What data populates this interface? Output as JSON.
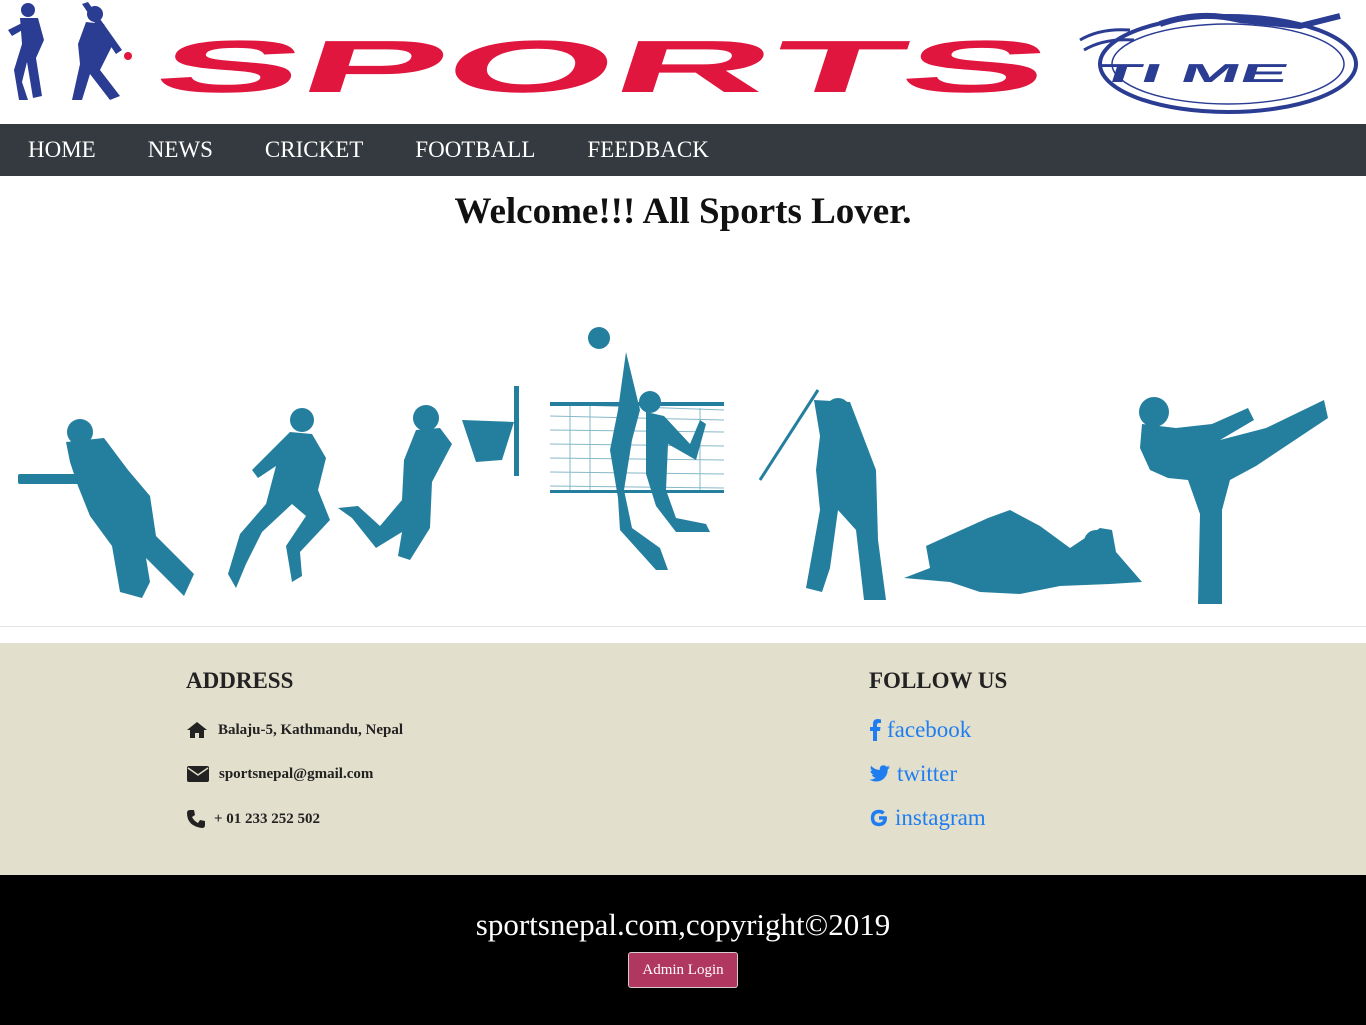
{
  "header": {
    "logo_alt": "Sports Time logo",
    "logo_text": "SPORTS",
    "logo_sub": "TI ME"
  },
  "nav": {
    "items": [
      {
        "label": "HOME"
      },
      {
        "label": "NEWS"
      },
      {
        "label": "CRICKET"
      },
      {
        "label": "FOOTBALL"
      },
      {
        "label": "FEEDBACK"
      }
    ]
  },
  "main": {
    "welcome": "Welcome!!! All Sports Lover."
  },
  "contact": {
    "address_title": "ADDRESS",
    "address": "Balaju-5, Kathmandu, Nepal",
    "email": "sportsnepal@gmail.com",
    "phone": "+ 01 233 252 502",
    "follow_title": "FOLLOW US",
    "social": [
      {
        "label": "facebook",
        "icon": "facebook-icon"
      },
      {
        "label": "twitter",
        "icon": "twitter-icon"
      },
      {
        "label": "instagram",
        "icon": "google-icon"
      }
    ]
  },
  "footer": {
    "copyright": "sportsnepal.com,copyright©2019",
    "admin_button": "Admin Login"
  },
  "colors": {
    "navbar": "#343a40",
    "logo_red": "#e0163f",
    "logo_blue": "#2b3c93",
    "silhouette": "#247f9e",
    "contact_bg": "#e3dfcd",
    "link": "#1e7ef0",
    "admin_button": "#b0375f"
  }
}
